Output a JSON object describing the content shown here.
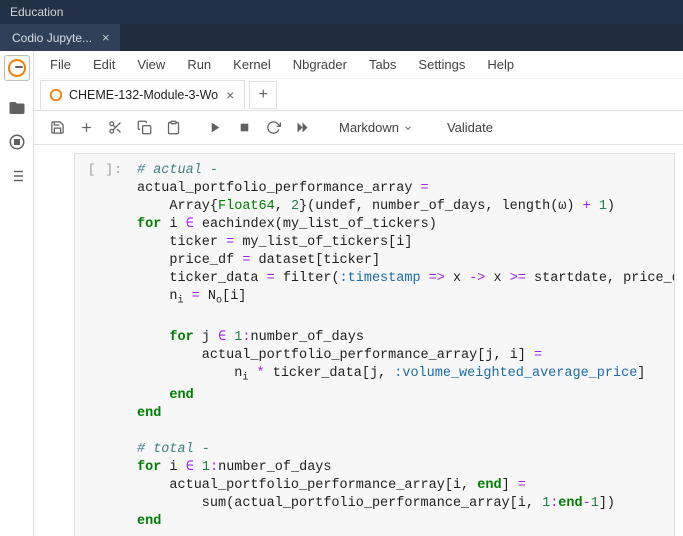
{
  "topbar": {
    "title": "Education"
  },
  "app_tab": {
    "label": "Codio Jupyte..."
  },
  "menus": [
    "File",
    "Edit",
    "View",
    "Run",
    "Kernel",
    "Nbgrader",
    "Tabs",
    "Settings",
    "Help"
  ],
  "nb_tab": {
    "label": "CHEME-132-Module-3-Wo"
  },
  "toolbar": {
    "cell_type": "Markdown",
    "validate": "Validate"
  },
  "cell": {
    "prompt": "[ ]:",
    "code": {
      "c1": "# actual -",
      "l2a": "actual_portfolio_performance_array ",
      "l2b": "=",
      "l3a": "    Array{",
      "l3b": "Float64",
      "l3c": ", ",
      "l3d": "2",
      "l3e": "}(undef, number_of_days, length(ω) ",
      "l3f": "+",
      "l3g": " ",
      "l3h": "1",
      "l3i": ")",
      "l4a": "for",
      "l4b": " i ",
      "l4c": "∈",
      "l4d": " eachindex(my_list_of_tickers)",
      "l5a": "    ticker ",
      "l5b": "=",
      "l5c": " my_list_of_tickers[i]",
      "l6a": "    price_df ",
      "l6b": "=",
      "l6c": " dataset[ticker]",
      "l7a": "    ticker_data ",
      "l7b": "=",
      "l7c": " filter(",
      "l7d": ":timestamp",
      "l7e": " ",
      "l7f": "=>",
      "l7g": " x ",
      "l7h": "->",
      "l7i": " x ",
      "l7j": ">=",
      "l7k": " startdate, price_df)",
      "l8a": "    n",
      "l8b": " ",
      "l8c": "=",
      "l8d": " N",
      "l8e": "[i]",
      "l10a": "    ",
      "l10b": "for",
      "l10c": " j ",
      "l10d": "∈",
      "l10e": " ",
      "l10f": "1",
      "l10g": ":",
      "l10h": "number_of_days",
      "l11a": "        actual_portfolio_performance_array[j, i] ",
      "l11b": "=",
      "l12a": "            n",
      "l12b": " ",
      "l12c": "*",
      "l12d": " ticker_data[j, ",
      "l12e": ":volume_weighted_average_price",
      "l12f": "]",
      "l13a": "    ",
      "l13b": "end",
      "l14a": "end",
      "c16": "# total -",
      "l17a": "for",
      "l17b": " i ",
      "l17c": "∈",
      "l17d": " ",
      "l17e": "1",
      "l17f": ":",
      "l17g": "number_of_days",
      "l18a": "    actual_portfolio_performance_array[i, ",
      "l18b": "end",
      "l18c": "] ",
      "l18d": "=",
      "l19a": "        sum(actual_portfolio_performance_array[i, ",
      "l19b": "1",
      "l19c": ":",
      "l19d": "end",
      "l19e": "-",
      "l19f": "1",
      "l19g": "])",
      "l20a": "end"
    }
  }
}
